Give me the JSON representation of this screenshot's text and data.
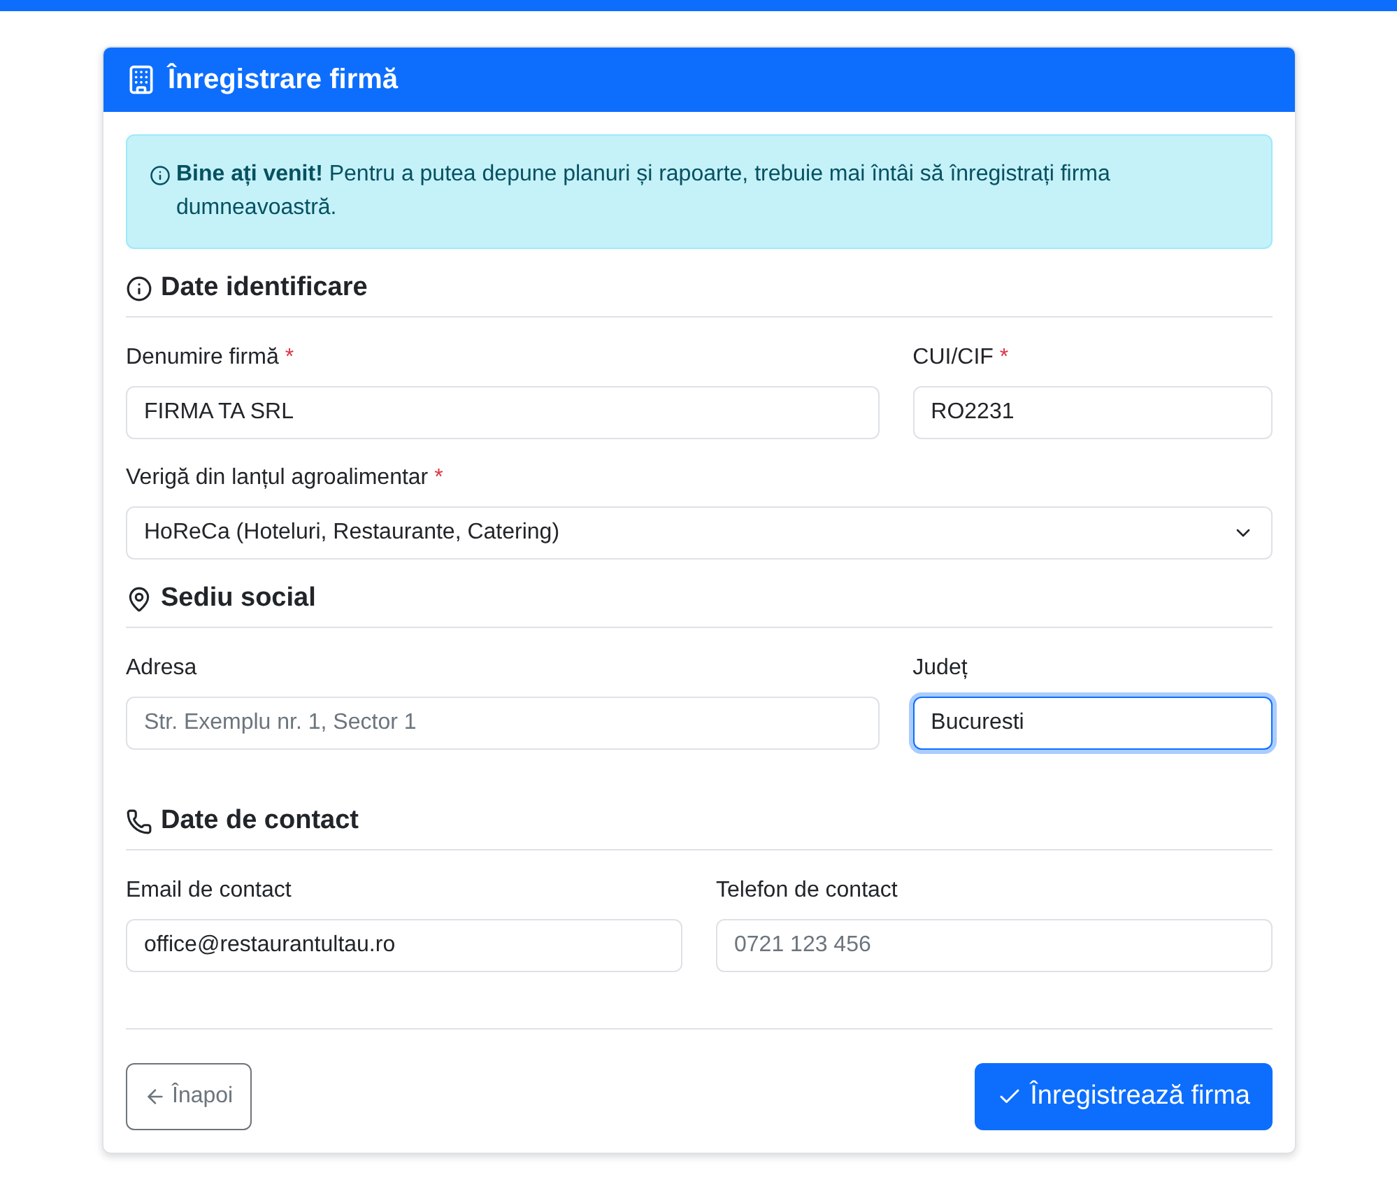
{
  "header": {
    "title": "Înregistrare firmă"
  },
  "alert": {
    "text": "**Bine ați venit!** Pentru a putea depune planuri și rapoarte, trebuie mai întâi să înregistrați firma dumneavoastră."
  },
  "sections": [
    {
      "title": "Date identificare",
      "rows": [
        {
          "fields": [
            {
              "kind": "text",
              "label": "Denumire firmă",
              "required_mark": "*",
              "value": "FIRMA TA SRL"
            },
            {
              "kind": "text",
              "label": "CUI/CIF",
              "required_mark": "*",
              "value": "RO2231"
            }
          ]
        },
        {
          "fields": [
            {
              "kind": "select",
              "label": "Verigă din lanțul agroalimentar",
              "required_mark": "*",
              "value": "HoReCa (Hoteluri, Restaurante, Catering)"
            }
          ]
        }
      ]
    },
    {
      "title": "Sediu social",
      "rows": [
        {
          "fields": [
            {
              "kind": "text",
              "label": "Adresa",
              "placeholder": "Str. Exemplu nr. 1, Sector 1"
            },
            {
              "kind": "text",
              "label": "Județ",
              "value": "Bucuresti",
              "focused": true
            }
          ]
        }
      ]
    },
    {
      "title": "Date de contact",
      "rows": [
        {
          "fields": [
            {
              "kind": "text",
              "label": "Email de contact",
              "value": "office@restaurantultau.ro"
            },
            {
              "kind": "text",
              "label": "Telefon de contact",
              "placeholder": "0721 123 456"
            }
          ]
        }
      ]
    }
  ],
  "buttons": {
    "back": "Înapoi",
    "submit": "Înregistrează firma"
  }
}
